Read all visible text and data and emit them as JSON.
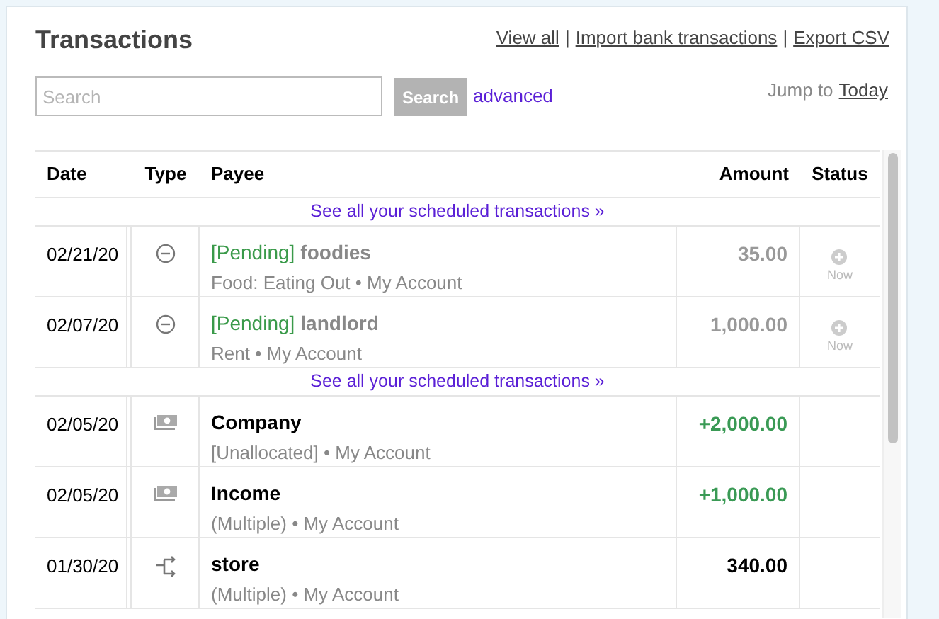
{
  "title": "Transactions",
  "top_links": [
    {
      "label": "View all"
    },
    {
      "label": "Import bank transactions"
    },
    {
      "label": "Export CSV"
    }
  ],
  "link_separator": "|",
  "search": {
    "placeholder": "Search",
    "button": "Search",
    "advanced": "advanced"
  },
  "jump": {
    "label": "Jump to",
    "link": "Today"
  },
  "table": {
    "columns": [
      "Date",
      "Type",
      "Payee",
      "Amount",
      "Status"
    ],
    "rows": [
      {
        "kind": "scheduled",
        "text": "See all your scheduled transactions »"
      },
      {
        "kind": "expense",
        "date": "02/21/20",
        "pending": true,
        "pending_label": "[Pending]",
        "payee": "foodies",
        "detail": "Food: Eating Out • My Account",
        "amount": "35.00",
        "status": "Now"
      },
      {
        "kind": "expense",
        "date": "02/07/20",
        "pending": true,
        "pending_label": "[Pending]",
        "payee": "landlord",
        "detail": "Rent • My Account",
        "amount": "1,000.00",
        "status": "Now"
      },
      {
        "kind": "scheduled",
        "text": "See all your scheduled transactions »"
      },
      {
        "kind": "income",
        "date": "02/05/20",
        "pending": false,
        "payee": "Company",
        "detail": "[Unallocated] • My Account",
        "amount": "+2,000.00",
        "incoming": true
      },
      {
        "kind": "income",
        "date": "02/05/20",
        "pending": false,
        "payee": "Income",
        "detail": "(Multiple) • My Account",
        "amount": "+1,000.00",
        "incoming": true
      },
      {
        "kind": "transfer",
        "date": "01/30/20",
        "pending": false,
        "payee": "store",
        "detail": "(Multiple) • My Account",
        "amount": "340.00",
        "incoming": false
      }
    ]
  }
}
